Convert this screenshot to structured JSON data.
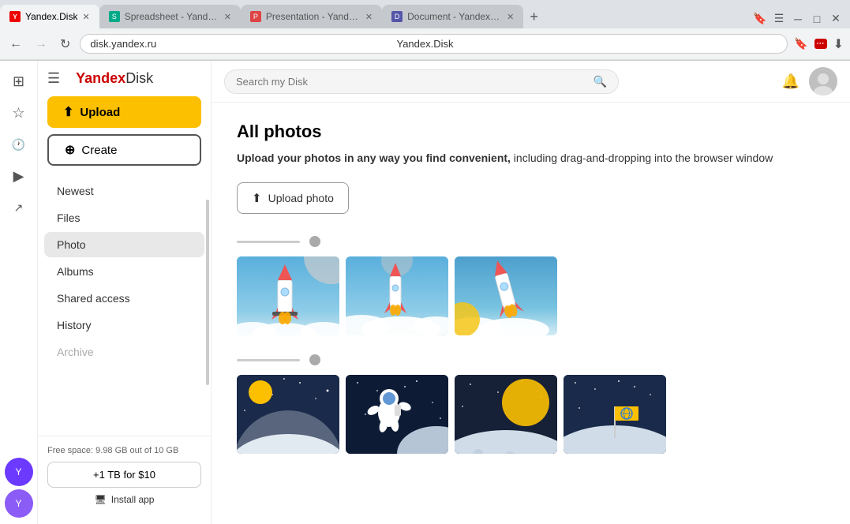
{
  "browser": {
    "tabs": [
      {
        "id": "tab-disk",
        "label": "Yandex.Disk",
        "favicon_type": "yandex-disk",
        "active": true
      },
      {
        "id": "tab-spreadsheet",
        "label": "Spreadsheet - Yande...",
        "favicon_type": "spreadsheet",
        "active": false
      },
      {
        "id": "tab-presentation",
        "label": "Presentation - Yande...",
        "favicon_type": "presentation",
        "active": false
      },
      {
        "id": "tab-document",
        "label": "Document - Yandex.D...",
        "favicon_type": "document",
        "active": false
      }
    ],
    "url": "disk.yandex.ru",
    "page_title": "Yandex.Disk"
  },
  "app_header": {
    "hamburger_label": "☰",
    "logo_yandex": "Yandex",
    "logo_disk": " Disk",
    "search_placeholder": "Search my Disk"
  },
  "sidebar": {
    "upload_label": "Upload",
    "create_label": "Create",
    "nav_items": [
      {
        "id": "newest",
        "label": "Newest",
        "active": false
      },
      {
        "id": "files",
        "label": "Files",
        "active": false
      },
      {
        "id": "photo",
        "label": "Photo",
        "active": true
      },
      {
        "id": "albums",
        "label": "Albums",
        "active": false
      },
      {
        "id": "shared",
        "label": "Shared access",
        "active": false
      },
      {
        "id": "history",
        "label": "History",
        "active": false
      },
      {
        "id": "archive",
        "label": "Archive",
        "active": false
      }
    ],
    "storage_text": "Free space: 9.98 GB out of 10 GB",
    "upgrade_label": "+1 TB for $10",
    "install_label": "Install app"
  },
  "main": {
    "page_title": "All photos",
    "page_desc_bold": "Upload your photos in any way you find convenient,",
    "page_desc_normal": " including drag-and-dropping into the browser window",
    "upload_photo_label": "Upload photo"
  },
  "icons": {
    "grid": "⊞",
    "star": "☆",
    "clock": "🕐",
    "play": "▶",
    "share": "↗",
    "bell": "🔔",
    "back": "←",
    "forward": "→",
    "reload": "↻",
    "bookmark": "🔖",
    "ext": "...",
    "download": "⬇",
    "up_arrow": "⬆",
    "plus": "+",
    "monitor": "🖥",
    "yandex_logo": "🔴"
  }
}
